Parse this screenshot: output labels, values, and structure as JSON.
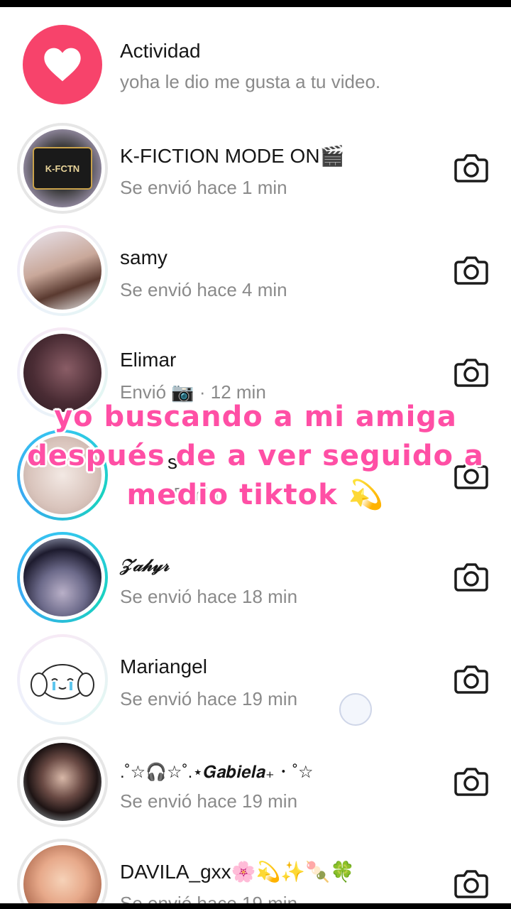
{
  "activity": {
    "title": "Actividad",
    "subtitle": "yoha le dio me gusta a tu video.",
    "icon": "heart-icon",
    "color": "#f7436b"
  },
  "rows": [
    {
      "name": "K-FICTION MODE ON🎬",
      "status": "Se envió hace 1 min",
      "avatar_text": "K-FCTN"
    },
    {
      "name": "samy",
      "status": "Se envió hace 4 min"
    },
    {
      "name": "Elimar",
      "status": "Envió 📷 · 12 min"
    },
    {
      "name": "s",
      "status": "15 min"
    },
    {
      "name": "𝒵𝒶𝒽𝓎𝓇",
      "status": "Se envió hace 18 min"
    },
    {
      "name": "Mariangel",
      "status": "Se envió hace 19 min"
    },
    {
      "name": ".˚☆🎧☆˚.⋆𝑮𝒂𝒃𝒊𝒆𝒍𝒂₊ ･ ˚☆",
      "status": "Se envió hace 19 min"
    },
    {
      "name": "DAVILA_gxx🌸💫✨🍡🍀",
      "status": "Se envió hace 19 min"
    }
  ],
  "overlay": {
    "caption": "yo buscando a mi amiga después de a ver seguido a medio tiktok 💫",
    "color": "#ff4fa5"
  }
}
